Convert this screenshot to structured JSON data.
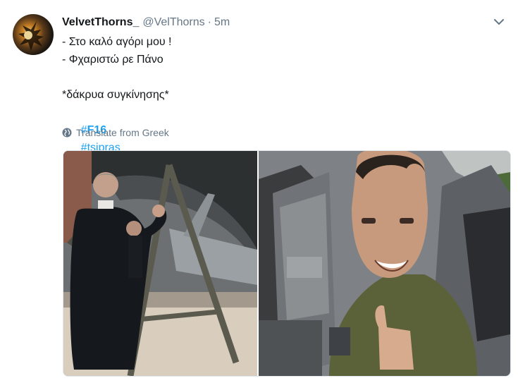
{
  "tweet": {
    "display_name": "VelvetThorns_",
    "handle": "@VelThorns",
    "separator": "·",
    "time": "5m",
    "lines": [
      "- Στο καλό αγόρι μου !",
      "- Φχαριστώ ρε Πάνο",
      "",
      "*δάκρυα συγκίνησης*"
    ],
    "hashtags": [
      {
        "symbol": "#",
        "tag": "F16"
      },
      {
        "symbol": "#",
        "tag": "tsipras"
      }
    ],
    "translate_label": "Translate from Greek"
  },
  "icons": {
    "caret": "chevron-down-icon",
    "globe": "globe-icon"
  },
  "colors": {
    "link": "#1da1f2",
    "secondary_text": "#657786",
    "primary_text": "#14171a"
  }
}
